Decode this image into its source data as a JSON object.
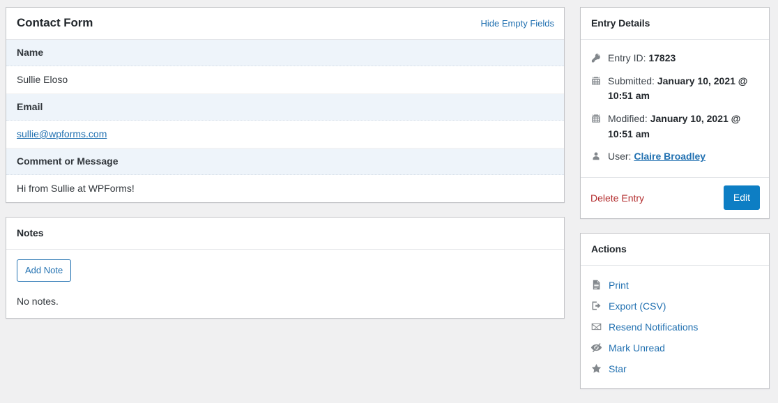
{
  "theme": {
    "page_bg": "#f0f0f1",
    "panel_bg": "#ffffff",
    "panel_border": "#c3c4c7",
    "label_row_bg": "#eef4fa",
    "link_blue": "#2271b1",
    "primary_button_bg": "#0d7ec4",
    "delete_red": "#b32d2e",
    "icon_gray": "#82878c",
    "text_dark": "#23282d"
  },
  "entry_form": {
    "title": "Contact Form",
    "toggle_link": "Hide Empty Fields",
    "fields": [
      {
        "label": "Name",
        "value": "Sullie Eloso",
        "is_link": false
      },
      {
        "label": "Email",
        "value": "sullie@wpforms.com",
        "is_link": true
      },
      {
        "label": "Comment or Message",
        "value": "Hi from Sullie at WPForms!",
        "is_link": false
      }
    ]
  },
  "notes": {
    "title": "Notes",
    "add_button": "Add Note",
    "empty_text": "No notes."
  },
  "entry_details": {
    "title": "Entry Details",
    "rows": [
      {
        "icon": "key-icon",
        "label": "Entry ID:",
        "value": "17823",
        "value_is_link": false
      },
      {
        "icon": "calendar-icon",
        "label": "Submitted:",
        "value": "January 10, 2021 @ 10:51 am",
        "value_is_link": false
      },
      {
        "icon": "calendar-icon",
        "label": "Modified:",
        "value": "January 10, 2021 @ 10:51 am",
        "value_is_link": false
      },
      {
        "icon": "user-icon",
        "label": "User:",
        "value": "Claire Broadley",
        "value_is_link": true
      }
    ],
    "delete_link": "Delete Entry",
    "edit_button": "Edit"
  },
  "actions": {
    "title": "Actions",
    "items": [
      {
        "icon": "document-icon",
        "label": "Print"
      },
      {
        "icon": "export-icon",
        "label": "Export (CSV)"
      },
      {
        "icon": "envelope-icon",
        "label": "Resend Notifications"
      },
      {
        "icon": "eye-slash-icon",
        "label": "Mark Unread"
      },
      {
        "icon": "star-icon",
        "label": "Star"
      }
    ]
  }
}
